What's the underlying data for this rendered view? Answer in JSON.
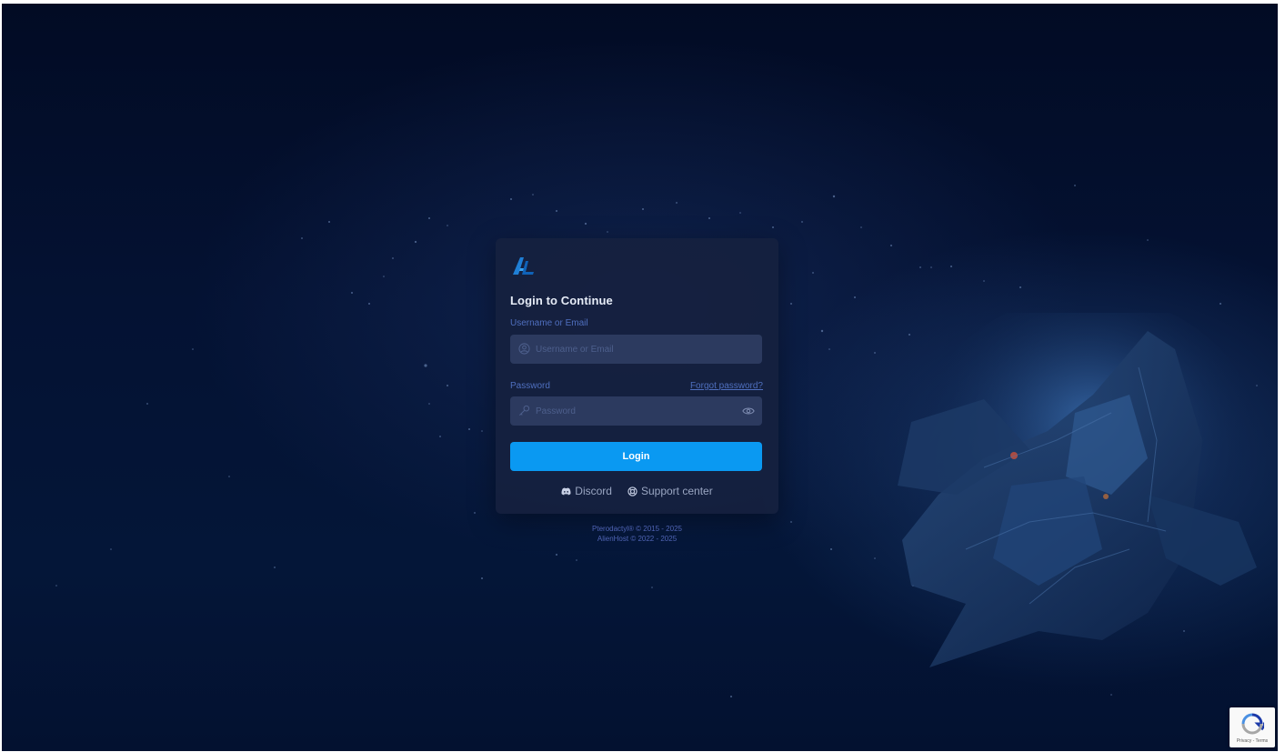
{
  "login": {
    "title": "Login to Continue",
    "username_label": "Username or Email",
    "username_placeholder": "Username or Email",
    "username_value": "",
    "password_label": "Password",
    "password_placeholder": "Password",
    "password_value": "",
    "forgot_link": "Forgot password?",
    "submit_label": "Login"
  },
  "links": {
    "discord": "Discord",
    "support": "Support center"
  },
  "footer": {
    "line1": "Pterodactyl® © 2015 - 2025",
    "line2": "AlienHost © 2022 - 2025"
  },
  "recaptcha": {
    "text": "Privacy - Terms"
  },
  "colors": {
    "accent": "#0a99f2",
    "card": "#16213f",
    "field": "#2c3a5f",
    "background": "#041233"
  },
  "icons": {
    "logo": "alienhost-logo",
    "user": "user-circle-icon",
    "password": "key-icon",
    "reveal": "eye-icon",
    "discord": "discord-icon",
    "support": "lifebuoy-icon",
    "recaptcha": "recaptcha-logo"
  }
}
